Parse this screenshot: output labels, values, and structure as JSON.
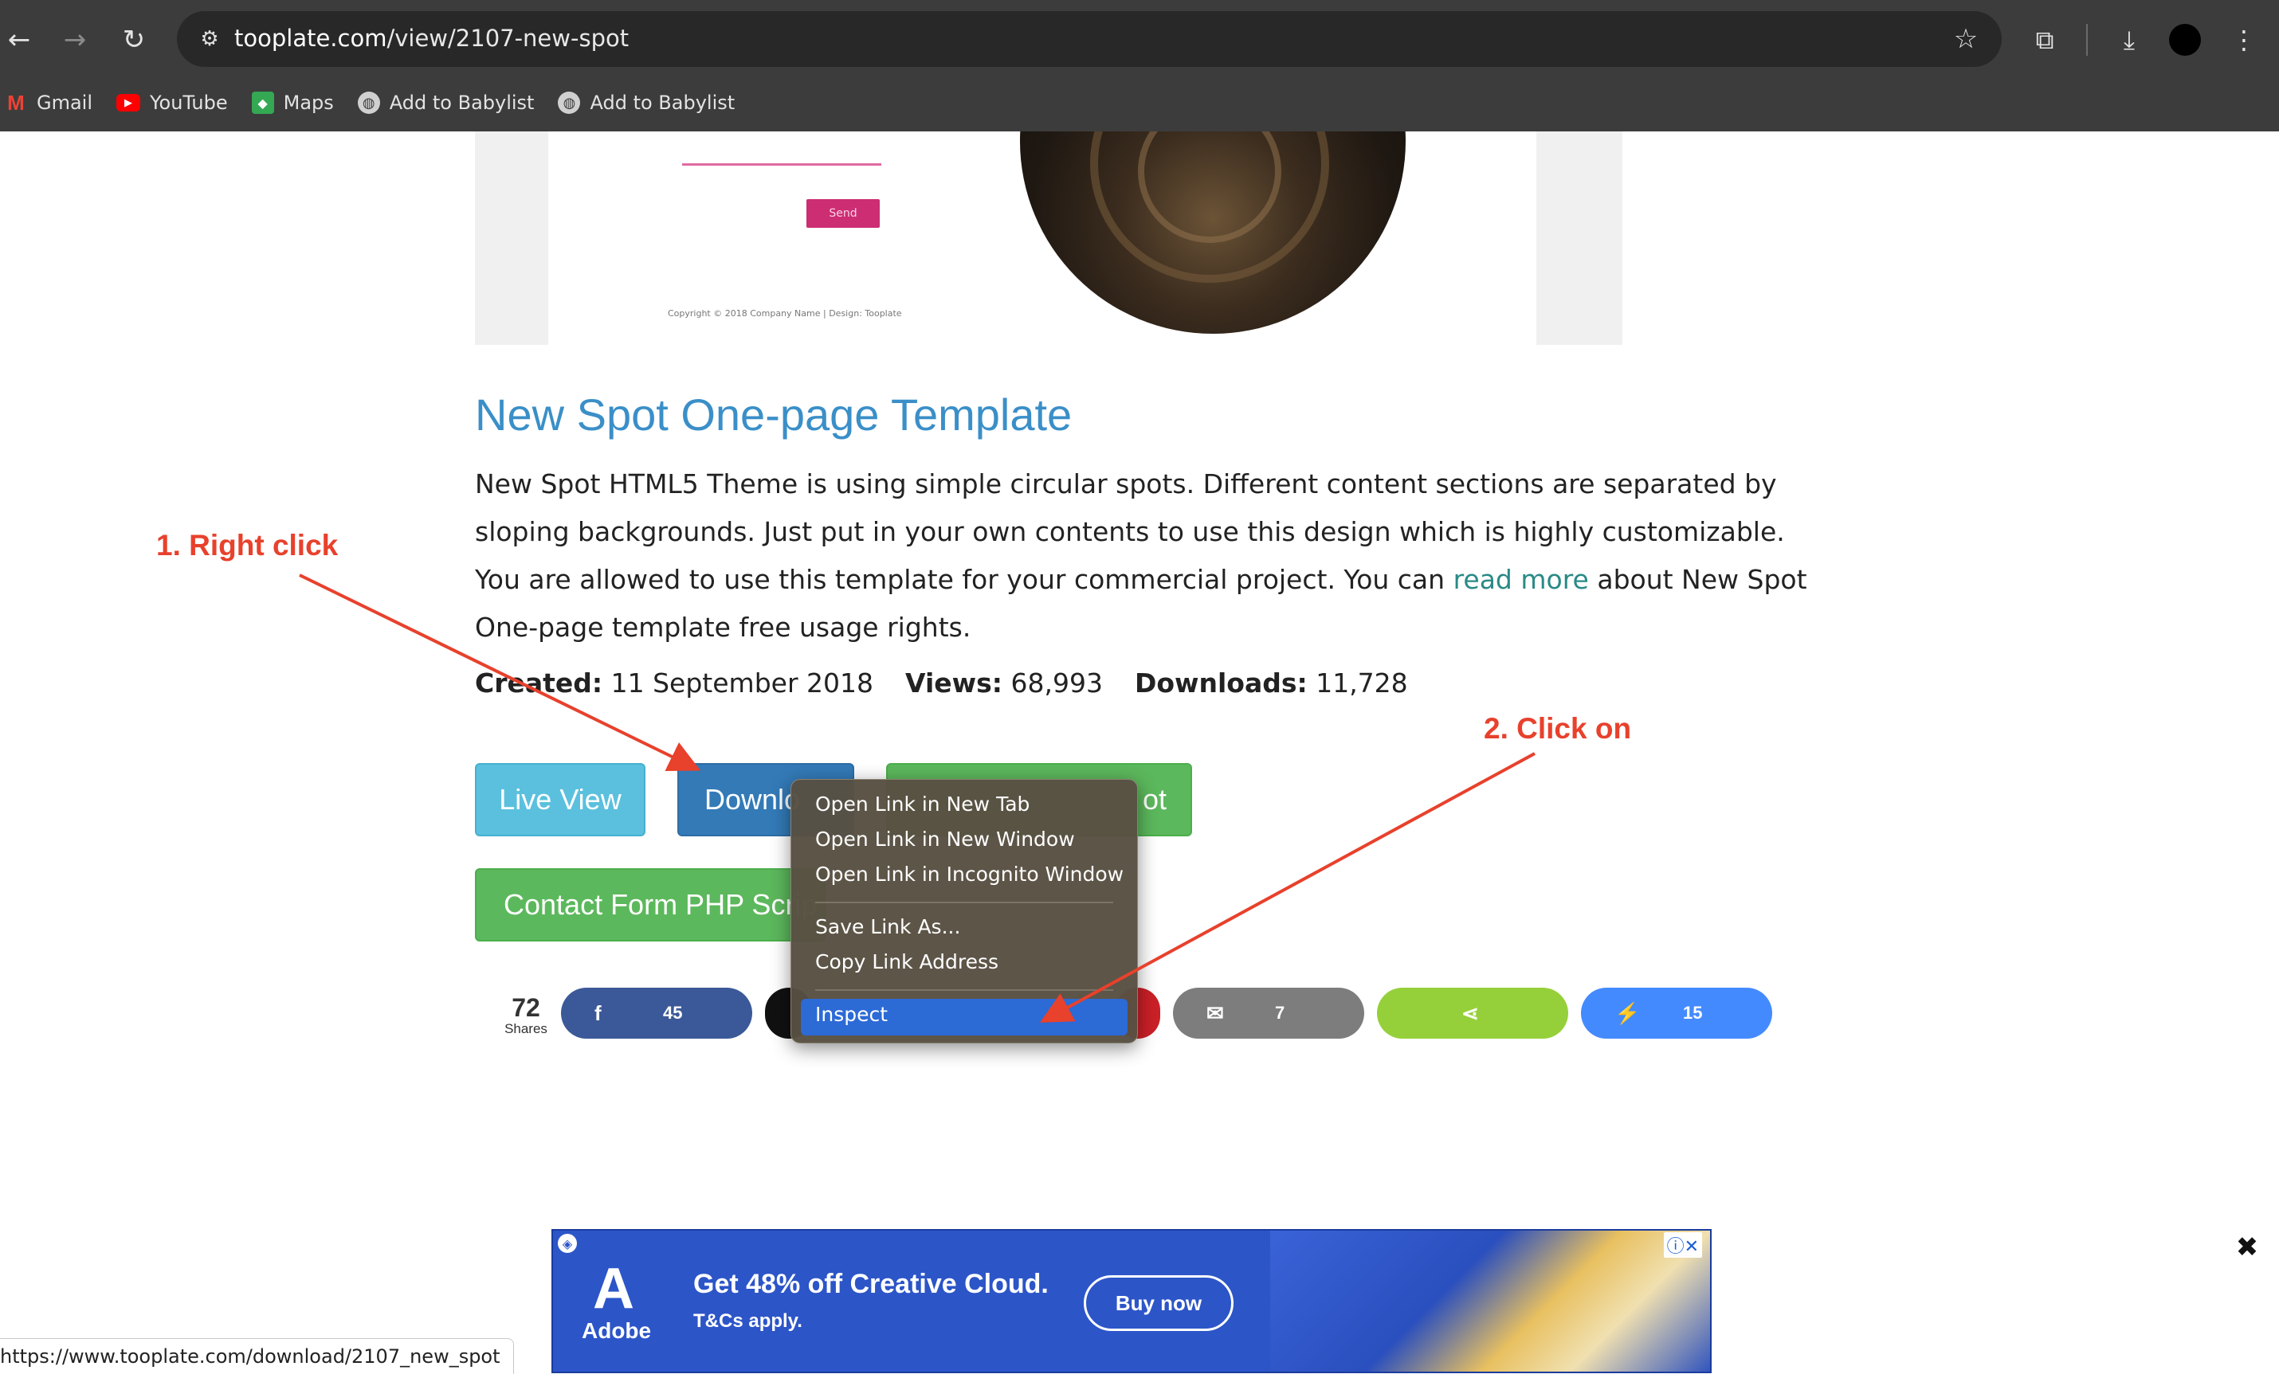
{
  "browser": {
    "url_host": "tooplate.com",
    "url_path": "/view/2107-new-spot",
    "bookmarks": [
      {
        "label": "Gmail",
        "icon": "gmail-icon"
      },
      {
        "label": "YouTube",
        "icon": "youtube-icon"
      },
      {
        "label": "Maps",
        "icon": "maps-icon"
      },
      {
        "label": "Add to Babylist",
        "icon": "globe-icon"
      },
      {
        "label": "Add to Babylist",
        "icon": "globe-icon"
      }
    ]
  },
  "preview": {
    "send_label": "Send",
    "copyright": "Copyright © 2018 Company Name | Design: Tooplate"
  },
  "template": {
    "title": "New Spot One-page Template",
    "description_before_link": "New Spot HTML5 Theme is using simple circular spots. Different content sections are separated by sloping backgrounds. Just put in your own contents to use this design which is highly customizable. You are allowed to use this template for your commercial project. You can ",
    "read_more": "read more",
    "description_after_link": " about New Spot One-page template free usage rights.",
    "created_label": "Created:",
    "created_value": "11 September 2018",
    "views_label": "Views:",
    "views_value": "68,993",
    "downloads_label": "Downloads:",
    "downloads_value": "11,728"
  },
  "buttons": {
    "live_view": "Live View",
    "download": "Downlo",
    "green_partial": "ot",
    "contact_form": "Contact Form PHP Scrip"
  },
  "share": {
    "total": "72",
    "total_label": "Shares",
    "facebook_count": "45",
    "email_count": "7",
    "messenger_count": "15"
  },
  "context_menu": {
    "items": [
      "Open Link in New Tab",
      "Open Link in New Window",
      "Open Link in Incognito Window",
      "Save Link As...",
      "Copy Link Address",
      "Inspect"
    ]
  },
  "annotations": {
    "step1": "1. Right click",
    "step2": "2. Click on",
    "color": "#e8412c"
  },
  "ad": {
    "brand": "Adobe",
    "headline": "Get 48% off Creative Cloud.",
    "subline": "T&Cs apply.",
    "cta": "Buy now"
  },
  "status_url": "https://www.tooplate.com/download/2107_new_spot",
  "colors": {
    "title_blue": "#3a8fc8",
    "link_teal": "#2a8a86",
    "live_view": "#5bc0de",
    "download": "#337ab7",
    "green": "#5cb85c",
    "menu_highlight": "#2c6ad6"
  }
}
